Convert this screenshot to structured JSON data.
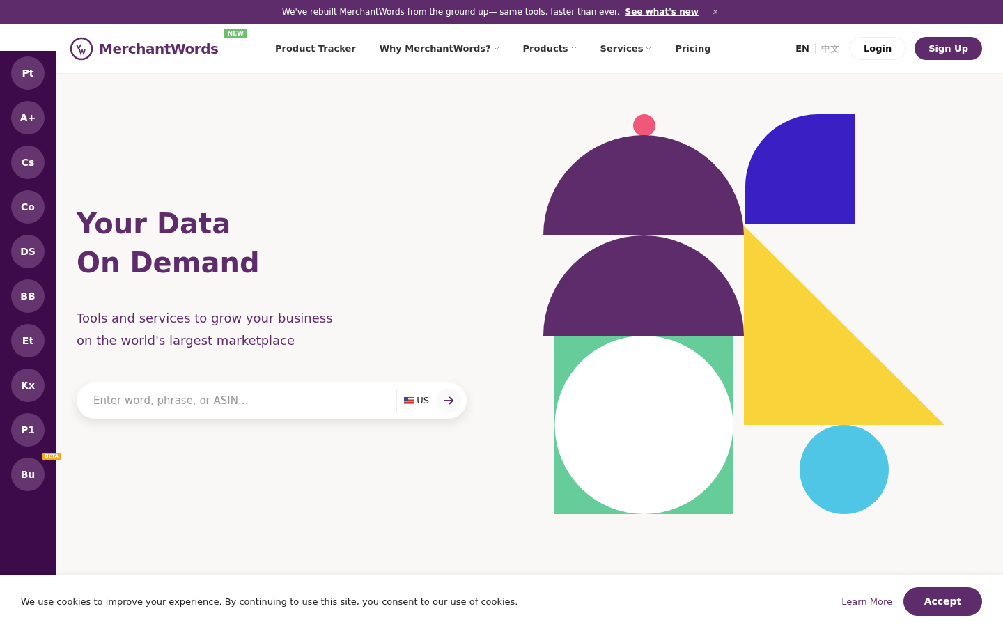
{
  "announcement": {
    "text": "We've rebuilt MerchantWords from the ground up— same tools, faster than ever.",
    "link": "See what's new",
    "close": "×"
  },
  "header": {
    "logo": "MerchantWords",
    "logo_badge": "NEW",
    "nav": [
      {
        "label": "Product Tracker",
        "has_menu": false
      },
      {
        "label": "Why MerchantWords?",
        "has_menu": true
      },
      {
        "label": "Products",
        "has_menu": true
      },
      {
        "label": "Services",
        "has_menu": true
      },
      {
        "label": "Pricing",
        "has_menu": false
      }
    ],
    "languages": [
      {
        "label": "EN",
        "selected": true
      },
      {
        "label": "中文",
        "selected": false
      }
    ],
    "login": "Login",
    "signup": "Sign Up"
  },
  "sidebar": [
    {
      "label": "Pt"
    },
    {
      "label": "A+"
    },
    {
      "label": "Cs"
    },
    {
      "label": "Co"
    },
    {
      "label": "DS"
    },
    {
      "label": "BB"
    },
    {
      "label": "Et"
    },
    {
      "label": "Kx"
    },
    {
      "label": "P1"
    },
    {
      "label": "Bu",
      "badge": "BETA"
    }
  ],
  "hero": {
    "title_lines": [
      "Your Data",
      "On Demand"
    ],
    "subtitle_lines": [
      "Tools and services to grow your business",
      "on the world's largest marketplace"
    ],
    "search": {
      "placeholder": "Enter word, phrase, or ASIN...",
      "country": "US"
    }
  },
  "cookie": {
    "text": "We use cookies to improve your experience. By continuing to use this site, you consent to our use of cookies.",
    "learn_more": "Learn More",
    "accept": "Accept"
  }
}
